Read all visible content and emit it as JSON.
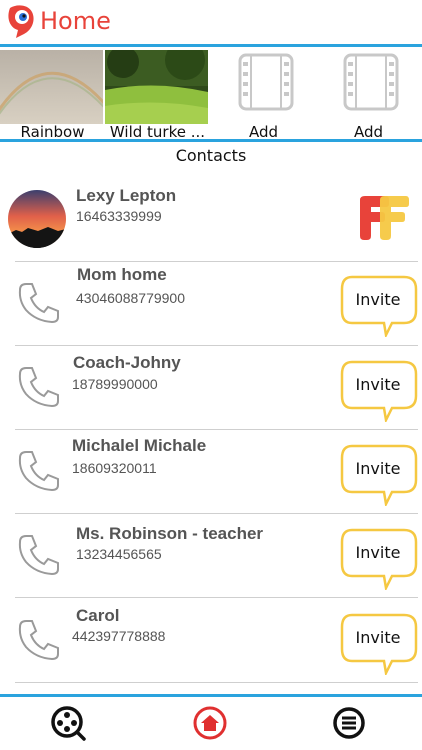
{
  "header": {
    "title": "Home",
    "logo_icon": "app-logo-icon"
  },
  "media": [
    {
      "label": "Rainbow",
      "type": "photo"
    },
    {
      "label": "Wild turke ...",
      "type": "photo"
    },
    {
      "label": "Add",
      "type": "add",
      "icon": "film-icon"
    },
    {
      "label": "Add",
      "type": "add",
      "icon": "film-icon"
    }
  ],
  "contacts_title": "Contacts",
  "contacts": [
    {
      "name": "Lexy Lepton",
      "number": "16463339999",
      "status": "member"
    },
    {
      "name": "Mom home",
      "number": "43046088779900",
      "action": "Invite"
    },
    {
      "name": "Coach-Johny",
      "number": "18789990000",
      "action": "Invite"
    },
    {
      "name": "Michalel Michale",
      "number": "18609320011",
      "action": "Invite"
    },
    {
      "name": "Ms. Robinson - teacher",
      "number": "13234456565",
      "action": "Invite"
    },
    {
      "name": "Carol",
      "number": "442397778888",
      "action": "Invite"
    }
  ],
  "bottom_nav": [
    {
      "icon": "film-reel-icon"
    },
    {
      "icon": "home-icon",
      "active": true
    },
    {
      "icon": "menu-icon"
    }
  ],
  "colors": {
    "accent_blue": "#2aa3de",
    "brand_red": "#e8433a",
    "invite_yellow": "#f5c842"
  }
}
